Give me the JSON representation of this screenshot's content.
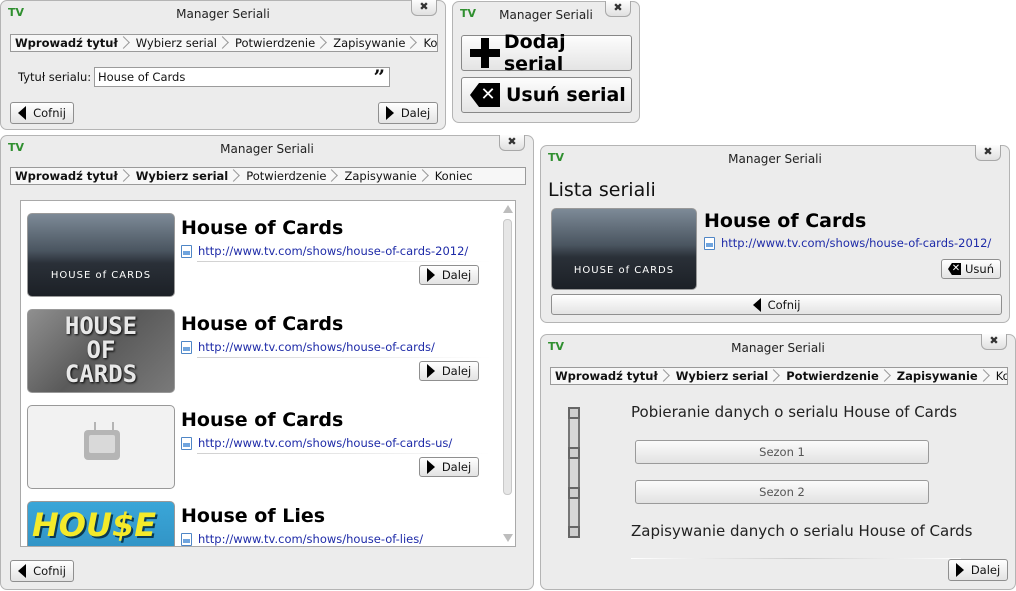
{
  "app": {
    "logo": "TV",
    "title": "Manager Seriali",
    "close_glyph": "✖"
  },
  "steps": [
    "Wprowadź tytuł",
    "Wybierz serial",
    "Potwierdzenie",
    "Zapisywanie",
    "Koniec"
  ],
  "buttons": {
    "back": "Cofnij",
    "next": "Dalej",
    "add_series": "Dodaj serial",
    "remove_series": "Usuń serial",
    "remove": "Usuń"
  },
  "win_title": {
    "label": "Tytuł serialu:",
    "value": "House of Cards",
    "quote_glyph": "”"
  },
  "win_choose": {
    "results": [
      {
        "title": "House of Cards",
        "url": "http://www.tv.com/shows/house-of-cards-2012/",
        "thumb_text": "HOUSE of CARDS"
      },
      {
        "title": "House of Cards",
        "url": "http://www.tv.com/shows/house-of-cards/",
        "thumb_text": "HOUSE OF CARDS"
      },
      {
        "title": "House of Cards",
        "url": "http://www.tv.com/shows/house-of-cards-us/",
        "thumb_text": ""
      },
      {
        "title": "House of Lies",
        "url": "http://www.tv.com/shows/house-of-lies/",
        "thumb_text": "HOU$E"
      }
    ]
  },
  "win_list": {
    "heading": "Lista seriali",
    "item": {
      "title": "House of Cards",
      "url": "http://www.tv.com/shows/house-of-cards-2012/",
      "thumb_text": "HOUSE of CARDS"
    }
  },
  "win_saving": {
    "download_text": "Pobieranie danych o serialu House of Cards",
    "seasons": [
      "Sezon 1",
      "Sezon 2"
    ],
    "save_text": "Zapisywanie danych o serialu House of Cards"
  },
  "colors": {
    "logo": "#2f8f2f",
    "link": "#1e2ba8",
    "window_bg": "#ececec"
  }
}
